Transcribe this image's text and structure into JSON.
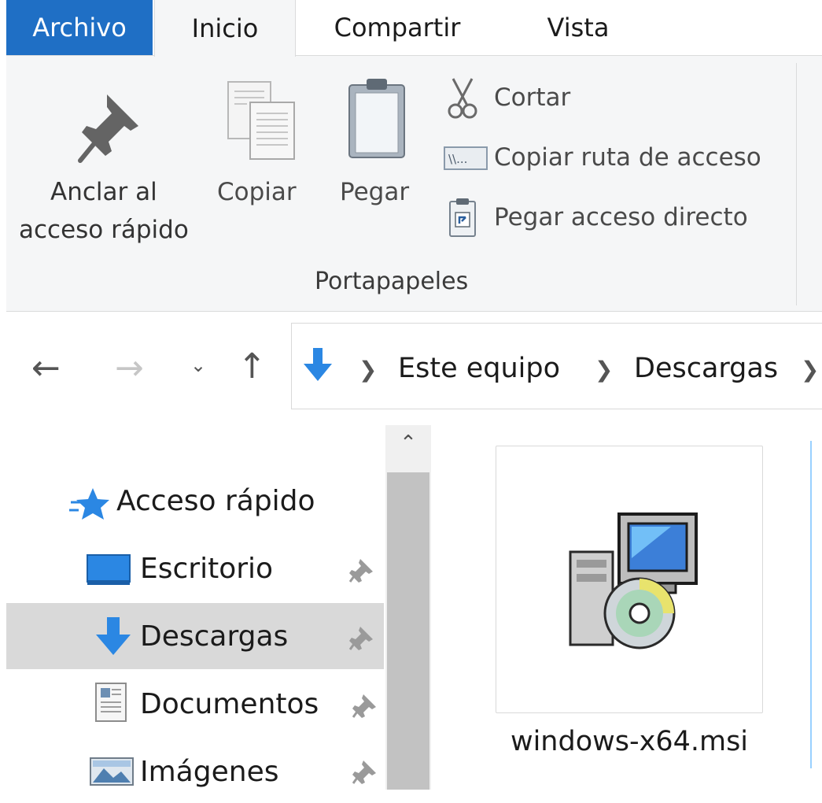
{
  "ribbon_tabs": {
    "archivo": "Archivo",
    "inicio": "Inicio",
    "compartir": "Compartir",
    "vista": "Vista"
  },
  "clipboard": {
    "pin_line1": "Anclar al",
    "pin_line2": "acceso rápido",
    "copy": "Copiar",
    "paste": "Pegar",
    "cut": "Cortar",
    "copy_path": "Copiar ruta de acceso",
    "paste_shortcut": "Pegar acceso directo",
    "group": "Portapapeles"
  },
  "breadcrumb": {
    "items": [
      "Este equipo",
      "Descargas"
    ]
  },
  "nav_pane": {
    "quick_access": "Acceso rápido",
    "items": [
      {
        "label": "Escritorio",
        "icon": "desktop-icon"
      },
      {
        "label": "Descargas",
        "icon": "download-arrow-icon"
      },
      {
        "label": "Documentos",
        "icon": "document-icon"
      },
      {
        "label": "Imágenes",
        "icon": "pictures-icon"
      }
    ],
    "selected_index": 1
  },
  "files": [
    {
      "name": "windows-x64.msi",
      "icon": "msi-installer-icon"
    }
  ],
  "colors": {
    "accent": "#1f6fc5",
    "ribbon_bg": "#f5f6f7",
    "selected_bg": "#d9d9d9",
    "folder_blue": "#2b87e3"
  }
}
